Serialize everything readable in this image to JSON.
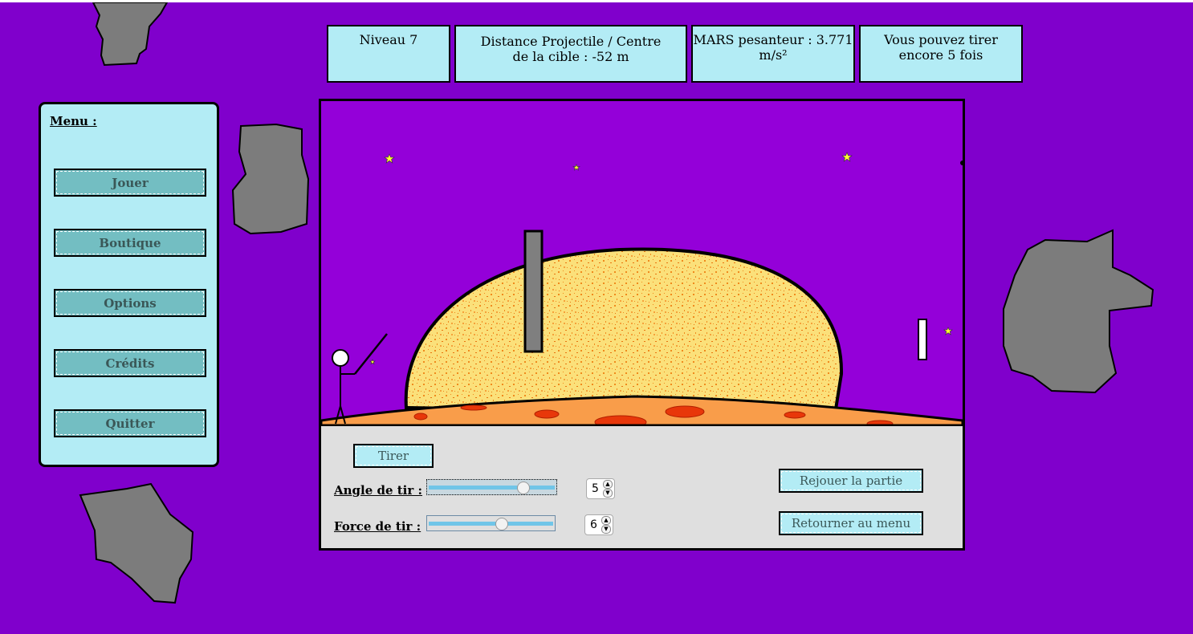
{
  "header": {
    "level": "Niveau 7",
    "distance_line1": "Distance Projectile / Centre",
    "distance_line2": "de la cible : -52 m",
    "gravity_line1": "MARS pesanteur : 3.771",
    "gravity_line2": "m/s²",
    "shots_line1": "Vous pouvez tirer",
    "shots_line2": "encore 5 fois"
  },
  "menu": {
    "title": "Menu :",
    "items": [
      {
        "label": "Jouer"
      },
      {
        "label": "Boutique"
      },
      {
        "label": "Options"
      },
      {
        "label": "Crédits"
      },
      {
        "label": "Quitter"
      }
    ]
  },
  "controls": {
    "fire_label": "Tirer",
    "angle_label": "Angle de tir :",
    "force_label": "Force de tir :",
    "angle_value": "5",
    "force_value": "6",
    "angle_slider_fraction": 0.78,
    "force_slider_fraction": 0.6,
    "replay_label": "Rejouer la partie",
    "back_label": "Retourner au menu"
  },
  "colors": {
    "background": "#8000cc",
    "sky": "#9400d9",
    "panel": "#b3ecf5",
    "menu_button": "#73bec2",
    "planet_fill": "#fbe07a",
    "planet_speckle": "#f08a1c",
    "ground": "#f99d4a",
    "crater": "#e8370a",
    "asteroid": "#7c7c7c",
    "star": "#ffff33"
  },
  "icons": [
    "stickman-archer",
    "star-icon",
    "asteroid"
  ]
}
